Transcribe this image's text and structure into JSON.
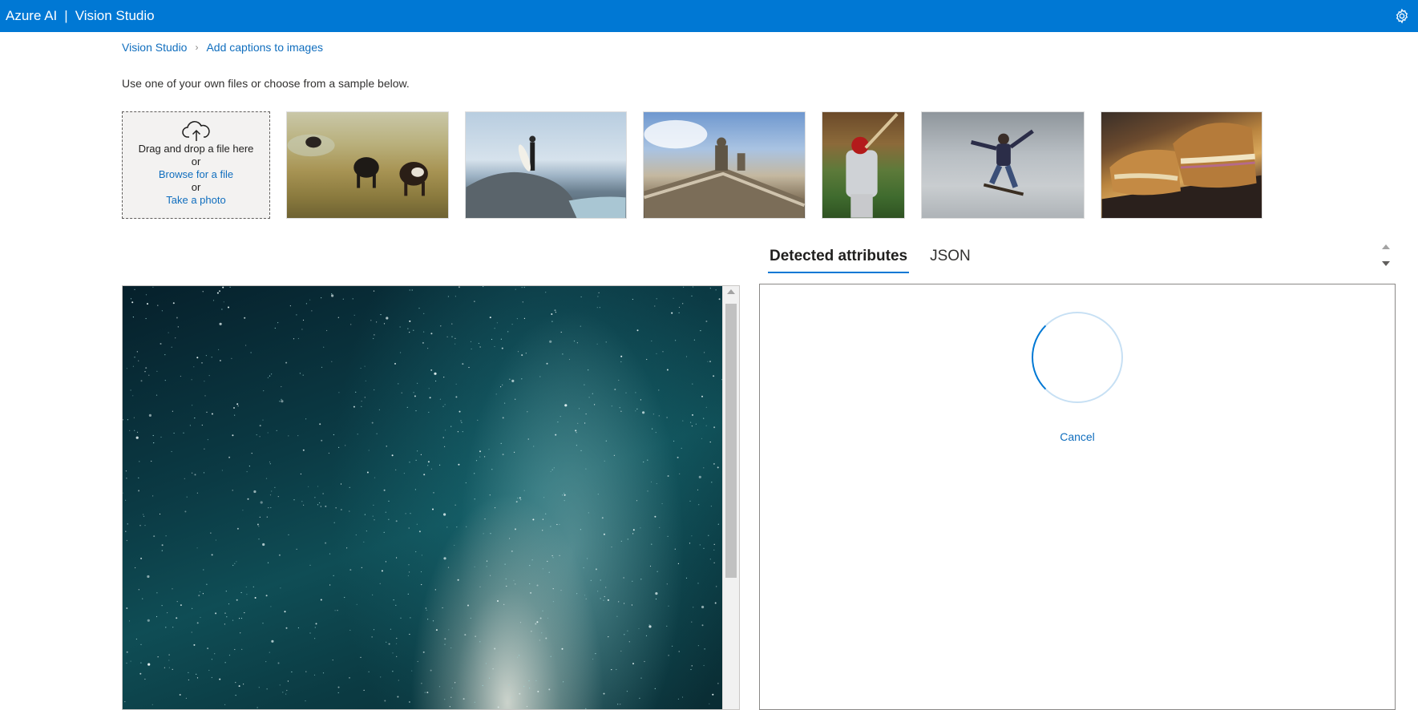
{
  "header": {
    "brand": "Azure AI",
    "separator": "|",
    "product": "Vision Studio",
    "settings_icon": "gear-icon"
  },
  "breadcrumb": {
    "root": "Vision Studio",
    "current": "Add captions to images"
  },
  "instruction": "Use one of your own files or choose from a sample below.",
  "upload": {
    "icon": "cloud-upload-icon",
    "drag_text": "Drag and drop a file here",
    "or1": "or",
    "browse_link": "Browse for a file",
    "or2": "or",
    "photo_link": "Take a photo"
  },
  "samples": [
    {
      "name": "cows-grazing"
    },
    {
      "name": "surfer-on-rock"
    },
    {
      "name": "building-statues"
    },
    {
      "name": "baseball-batter"
    },
    {
      "name": "skateboarder"
    },
    {
      "name": "grilled-sandwich"
    }
  ],
  "tabs": {
    "active": "Detected attributes",
    "other": "JSON"
  },
  "results": {
    "state": "loading",
    "cancel_label": "Cancel"
  },
  "colors": {
    "topbar": "#0078d4",
    "link": "#106ebe",
    "tab_underline": "#0078d4"
  }
}
